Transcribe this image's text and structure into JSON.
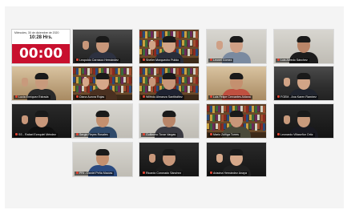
{
  "meeting": {
    "clock": {
      "date": "Miércoles, 30 de diciembre de 2020",
      "time": "10:28 Hrs.",
      "countdown": "00:00"
    },
    "participants": [
      {
        "name": "Leopoldo Carrasco Hernández",
        "theme": "dark-office",
        "shirt": "#2d3140",
        "skin": "#c8977a",
        "hand": true
      },
      {
        "name": "Sheller Morquecho Pulido",
        "theme": "bookshelf",
        "shirt": "#2a2e3a",
        "skin": "#d1a487",
        "hand": true
      },
      {
        "name": "Leonel Gómez",
        "theme": "light-wall",
        "shirt": "#7a8aa0",
        "skin": "#cfa086",
        "hand": true
      },
      {
        "name": "Luis Alfredo Sánchez",
        "theme": "light-wall",
        "shirt": "#1c1c1c",
        "skin": "#b98568",
        "hand": false
      },
      {
        "name": "Lucía Enríquez Estrada",
        "theme": "warm-room",
        "shirt": "#2a2a2a",
        "skin": "#c89a7c",
        "hand": true
      },
      {
        "name": "Diana Aurora Rojas",
        "theme": "bookshelf",
        "shirt": "#4a3020",
        "skin": "#d6a88a",
        "hand": true
      },
      {
        "name": "Wilfrido Almanza Santibáñez",
        "theme": "bookshelf",
        "shirt": "#1e2230",
        "skin": "#c8977a",
        "hand": true
      },
      {
        "name": "Luis Felipe Cervantes Aldana",
        "theme": "warm-room",
        "shirt": "#c05040",
        "skin": "#c4906f",
        "hand": false
      },
      {
        "name": "FGEM - Ana Karen Ramírez",
        "theme": "dark-office",
        "shirt": "#20242e",
        "skin": "#d1a487",
        "hand": true
      },
      {
        "name": "SS - Rafael Ezequiel Méndez",
        "theme": "dark",
        "shirt": "#101010",
        "skin": "#c8977a",
        "hand": true
      },
      {
        "name": "Sergio Reyes Rosales",
        "theme": "light-wall",
        "shirt": "#2f4a6a",
        "skin": "#c4906f",
        "hand": false
      },
      {
        "name": "Guillermo Tovar Vargas",
        "theme": "light-wall",
        "shirt": "#3a3a42",
        "skin": "#b98568",
        "hand": false
      },
      {
        "name": "Mario Zúñiga Torres",
        "theme": "bookshelf",
        "shirt": "#4a4a3a",
        "skin": "#c8977a",
        "hand": false
      },
      {
        "name": "Leonardo Villaseñor Ortiz",
        "theme": "dark",
        "shirt": "#1a1a22",
        "skin": "#c89a7c",
        "hand": true
      },
      {
        "name": "PRI - Daniel Peña Macías",
        "theme": "light-wall",
        "shirt": "#2a4a80",
        "skin": "#c4906f",
        "hand": false
      },
      {
        "name": "Ricardo Coronado Sánchez",
        "theme": "dark",
        "shirt": "#1c1c1c",
        "skin": "#c8977a",
        "hand": true
      },
      {
        "name": "Ariadna Hernández Anaya",
        "theme": "dark",
        "shirt": "#202020",
        "skin": "#d6a88a",
        "hand": true
      }
    ]
  },
  "colors": {
    "countdown_bg": "#c8102e",
    "tile_border": "#dcdcdc",
    "name_bar": "rgba(0,0,0,0.55)"
  }
}
